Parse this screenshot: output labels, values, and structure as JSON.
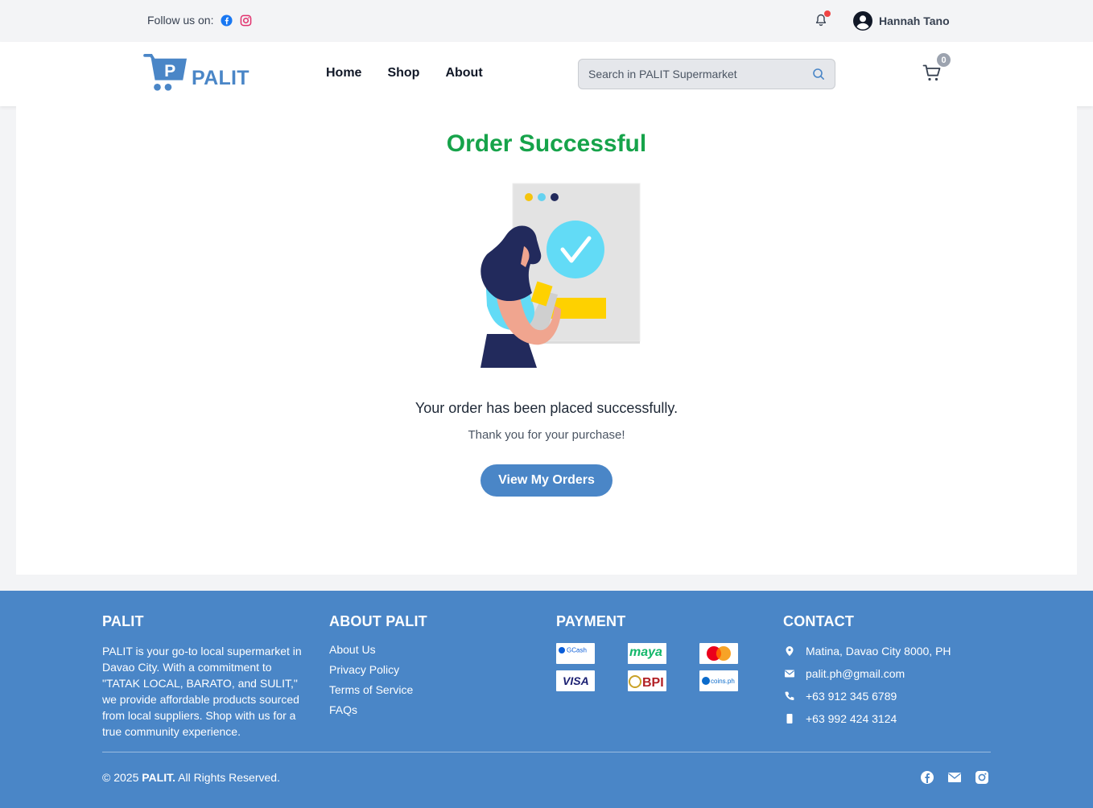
{
  "topbar": {
    "follow_label": "Follow us on:",
    "social_icons": [
      "facebook-icon",
      "instagram-icon"
    ],
    "user_name": "Hannah Tano"
  },
  "header": {
    "logo_text": "PALIT",
    "nav": [
      "Home",
      "Shop",
      "About"
    ],
    "search_placeholder": "Search in PALIT Supermarket",
    "cart_count": "0"
  },
  "main": {
    "title": "Order Successful",
    "message": "Your order has been placed successfully.",
    "sub_message": "Thank you for your purchase!",
    "button_label": "View My Orders"
  },
  "footer": {
    "palit": {
      "heading": "PALIT",
      "text": "PALIT is your go-to local supermarket in Davao City. With a commitment to \"TATAK LOCAL, BARATO, and SULIT,\" we provide affordable products sourced from local suppliers. Shop with us for a true community experience."
    },
    "about": {
      "heading": "ABOUT PALIT",
      "links": [
        "About Us",
        "Privacy Policy",
        "Terms of Service",
        "FAQs"
      ]
    },
    "payment": {
      "heading": "PAYMENT",
      "methods": [
        "GCash",
        "maya",
        "Mastercard",
        "VISA",
        "BPI",
        "coins.ph"
      ]
    },
    "contact": {
      "heading": "CONTACT",
      "address": "Matina, Davao City 8000, PH",
      "email": "palit.ph@gmail.com",
      "phone": "+63 912 345 6789",
      "mobile": "+63 992 424 3124"
    },
    "copyright_prefix": "© 2025",
    "copyright_brand": "PALIT.",
    "copyright_suffix": "All Rights Reserved."
  },
  "colors": {
    "brand_blue": "#4a86c7",
    "success_green": "#16a34a",
    "notification_dot": "#ef4444"
  }
}
